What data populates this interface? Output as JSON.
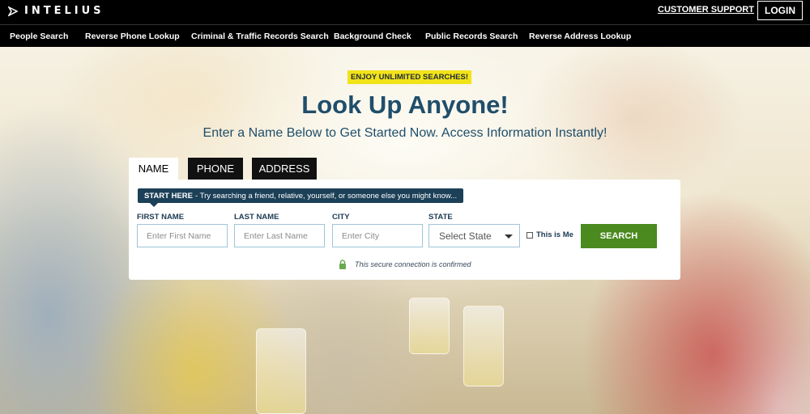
{
  "brand": {
    "name": "INTELIUS",
    "logo_icon": "arrow-mark-icon"
  },
  "header": {
    "support_label": "CUSTOMER SUPPORT",
    "login_label": "LOGIN"
  },
  "nav": {
    "items": [
      {
        "label": "People Search"
      },
      {
        "label": "Reverse Phone Lookup"
      },
      {
        "label": "Criminal & Traffic Records Search"
      },
      {
        "label": "Background Check"
      },
      {
        "label": "Public Records Search"
      },
      {
        "label": "Reverse Address Lookup"
      }
    ]
  },
  "hero": {
    "badge": "ENJOY UNLIMITED SEARCHES!",
    "headline": "Look Up Anyone!",
    "subheadline": "Enter a Name Below to Get Started Now. Access Information Instantly!"
  },
  "tabs": [
    {
      "label": "NAME",
      "active": true
    },
    {
      "label": "PHONE",
      "active": false
    },
    {
      "label": "ADDRESS",
      "active": false
    }
  ],
  "form": {
    "start_here_bold": "START HERE",
    "start_here_text": "- Try searching a friend, relative, yourself, or someone else you might know...",
    "fields": {
      "first_name": {
        "label": "FIRST NAME",
        "placeholder": "Enter First Name"
      },
      "last_name": {
        "label": "LAST NAME",
        "placeholder": "Enter Last Name"
      },
      "city": {
        "label": "CITY",
        "placeholder": "Enter City"
      },
      "state": {
        "label": "STATE",
        "value": "Select State"
      }
    },
    "this_is_me_label": "This is Me",
    "this_is_me_checked": false,
    "search_label": "SEARCH",
    "secure_text": "This secure connection is confirmed",
    "secure_icon": "lock-icon"
  },
  "colors": {
    "navy": "#1f4e6b",
    "badge_yellow": "#f2e318",
    "search_green": "#4a8a1f",
    "start_here_bg": "#1c4058",
    "lock_green": "#6aa84f"
  }
}
